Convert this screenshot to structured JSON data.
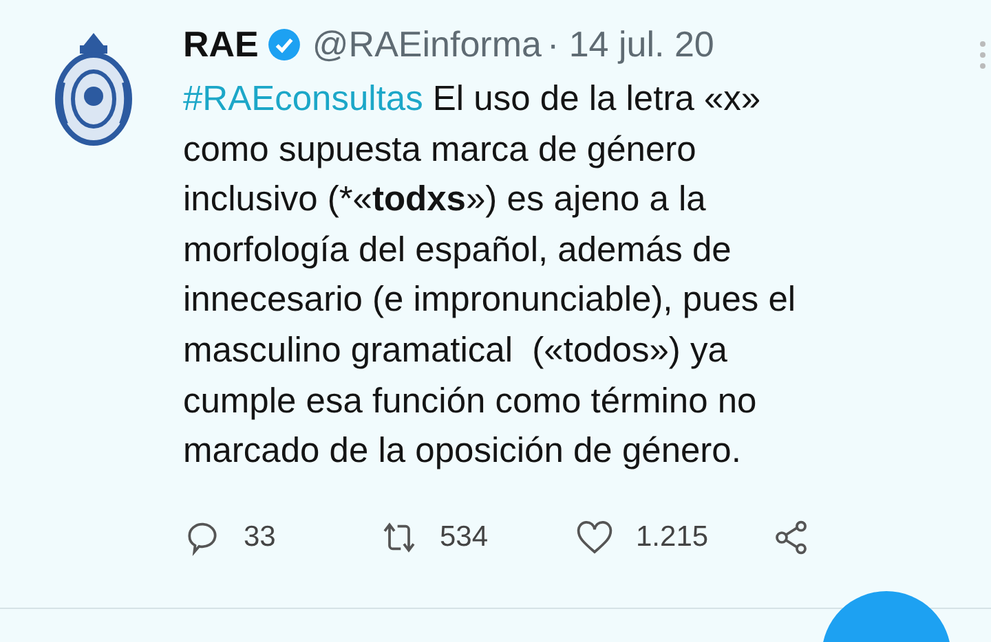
{
  "tweet": {
    "name": "RAE",
    "verified": true,
    "handle": "@RAEinforma",
    "date": "· 14 jul. 20",
    "hashtag": "#RAEconsultas",
    "text": " El uso de la letra «x»\ncomo supuesta marca de género\ninclusivo (*«**todxs**») es ajeno a la\nmorfología del español, además de\ninnecesario (e impronunciable), pues el\nmasculino gramatical  («todos») ya\ncumple esa función como término no\nmarcado de la oposición de género.",
    "actions": [
      {
        "kind": "reply",
        "count": "33"
      },
      {
        "kind": "retweet",
        "count": "534"
      },
      {
        "kind": "like",
        "count": "1.215"
      },
      {
        "kind": "share"
      }
    ]
  }
}
